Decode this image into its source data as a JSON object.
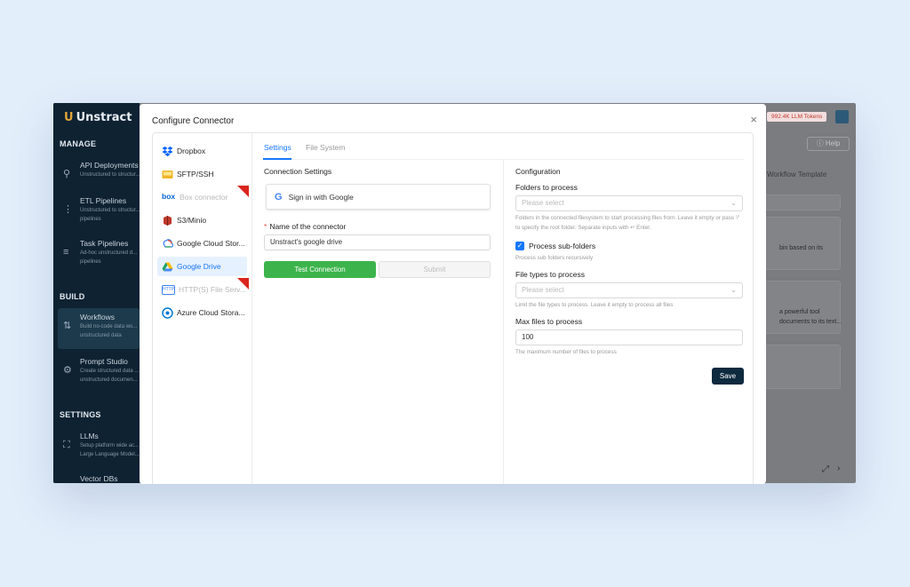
{
  "app": {
    "brand": "Unstract",
    "tokens": "992.4K LLM Tokens",
    "help_label": "Help",
    "workflow_template": "Workflow Template",
    "bg_snippets": [
      "bin based on its",
      "a powerful tool",
      "documents to its text..."
    ],
    "sections": {
      "manage": "MANAGE",
      "build": "BUILD",
      "settings": "SETTINGS"
    },
    "nav": [
      {
        "title": "API Deployments",
        "desc": "Unstructured to structur..."
      },
      {
        "title": "ETL Pipelines",
        "desc": "Unstructured to structur... pipelines"
      },
      {
        "title": "Task Pipelines",
        "desc": "Ad-hoc unstructured d... pipelines"
      },
      {
        "title": "Workflows",
        "desc": "Build no-code data wo... unstructured data"
      },
      {
        "title": "Prompt Studio",
        "desc": "Create structured data ... unstructured documen..."
      },
      {
        "title": "LLMs",
        "desc": "Setup platform wide ac... Large Language Model..."
      },
      {
        "title": "Vector DBs",
        "desc": ""
      }
    ]
  },
  "modal": {
    "title": "Configure Connector",
    "close_icon": "×",
    "connectors": [
      {
        "label": "Dropbox",
        "icon": "dropbox-icon",
        "color": "#0061fe"
      },
      {
        "label": "SFTP/SSH",
        "icon": "sftp-icon",
        "color": "#f0b429"
      },
      {
        "label": "Box connector",
        "icon": "box-icon",
        "color": "#0061d5"
      },
      {
        "label": "S3/Minio",
        "icon": "s3-icon",
        "color": "#c0392b"
      },
      {
        "label": "Google Cloud Stor...",
        "icon": "gcs-icon",
        "color": "#4285f4"
      },
      {
        "label": "Google Drive",
        "icon": "google-drive-icon",
        "color": "#1fa463"
      },
      {
        "label": "HTTP(S) File Serv...",
        "icon": "http-icon",
        "color": "#3b82f6"
      },
      {
        "label": "Azure Cloud Stora...",
        "icon": "azure-icon",
        "color": "#0078d4"
      }
    ],
    "tabs": {
      "settings": "Settings",
      "file_system": "File System"
    },
    "left": {
      "heading": "Connection Settings",
      "google_signin": "Sign in with Google",
      "google_g": "G",
      "required_mark": "*",
      "name_label": "Name of the connector",
      "name_value": "Unstract's google drive",
      "test_button": "Test Connection",
      "submit_button": "Submit"
    },
    "right": {
      "heading": "Configuration",
      "folders_label": "Folders to process",
      "folders_placeholder": "Please select",
      "folders_help": "Folders in the connected filesystem to start processing files from. Leave it empty or pass '/' to specify the root folder. Separate inputs with ↵ Enter.",
      "subfolders_label": "Process sub-folders",
      "subfolders_help": "Process sub folders recursively",
      "filetypes_label": "File types to process",
      "filetypes_placeholder": "Please select",
      "filetypes_help": "Limit the file types to process. Leave it empty to process all files",
      "maxfiles_label": "Max files to process",
      "maxfiles_value": "100",
      "maxfiles_help": "The maximum number of files to process",
      "save_button": "Save"
    }
  }
}
